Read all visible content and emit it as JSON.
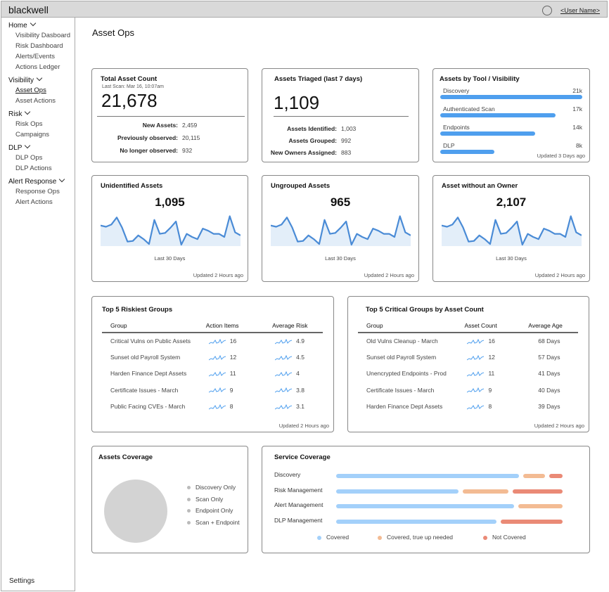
{
  "app": {
    "brand": "blackwell",
    "user_name": "<User Name>",
    "settings": "Settings"
  },
  "sidebar": [
    {
      "label": "Home",
      "items": [
        "Visibility Dasboard",
        "Risk Dashboard",
        "Alerts/Events",
        "Actions Ledger"
      ]
    },
    {
      "label": "Visibility",
      "items": [
        "Asset Ops",
        "Asset Actions"
      ],
      "active": "Asset Ops"
    },
    {
      "label": "Risk",
      "items": [
        "Risk Ops",
        "Campaigns"
      ]
    },
    {
      "label": "DLP",
      "items": [
        "DLP Ops",
        "DLP Actions"
      ]
    },
    {
      "label": "Alert Response",
      "items": [
        "Response Ops",
        "Alert Actions"
      ]
    }
  ],
  "page_title": "Asset Ops",
  "total": {
    "title": "Total Asset Count",
    "last_scan": "Last Scan: Mar 16, 10:07am",
    "value": "21,678",
    "rows": [
      {
        "k": "New Assets:",
        "v": "2,459"
      },
      {
        "k": "Previously observed:",
        "v": "20,115"
      },
      {
        "k": "No longer observed:",
        "v": "932"
      }
    ]
  },
  "triaged": {
    "title": "Assets Triaged (last 7 days)",
    "value": "1,109",
    "rows": [
      {
        "k": "Assets Identified:",
        "v": "1,003"
      },
      {
        "k": "Assets Grouped:",
        "v": "992"
      },
      {
        "k": "New Owners Assigned:",
        "v": "883"
      }
    ]
  },
  "by_tool": {
    "title": "Assets by Tool / Visibility",
    "updated": "Updated 3 Days ago",
    "color": "#4f9fee",
    "bars": [
      {
        "label": "Discovery",
        "value": "21k",
        "n": 21
      },
      {
        "label": "Authenticated Scan",
        "value": "17k",
        "n": 17
      },
      {
        "label": "Endpoints",
        "value": "14k",
        "n": 14
      },
      {
        "label": "DLP",
        "value": "8k",
        "n": 8
      }
    ]
  },
  "trend_cards": [
    {
      "title": "Unidentified Assets",
      "value": "1,095",
      "period": "Last 30 Days",
      "updated": "Updated 2 Hours ago"
    },
    {
      "title": "Ungrouped Assets",
      "value": "965",
      "period": "Last 30 Days",
      "updated": "Updated 2 Hours ago"
    },
    {
      "title": "Asset without an Owner",
      "value": "2,107",
      "period": "Last 30 Days",
      "updated": "Updated 2 Hours ago"
    }
  ],
  "sparkline": {
    "values": [
      62,
      58,
      65,
      88,
      55,
      10,
      12,
      30,
      18,
      2,
      80,
      35,
      38,
      55,
      75,
      0,
      35,
      25,
      18,
      52,
      45,
      35,
      35,
      25,
      92,
      40,
      30
    ],
    "line_color": "#4a8bd6",
    "fill_color": "#e3eef9"
  },
  "riskiest": {
    "title": "Top 5 Riskiest Groups",
    "updated": "Updated 2 Hours ago",
    "columns": [
      "Group",
      "Action Items",
      "Average Risk"
    ],
    "rows": [
      [
        "Critical Vulns on Public Assets",
        "16",
        "4.9"
      ],
      [
        "Sunset old Payroll System",
        "12",
        "4.5"
      ],
      [
        "Harden Finance Dept Assets",
        "11",
        "4"
      ],
      [
        "Certificate Issues - March",
        "9",
        "3.8"
      ],
      [
        "Public Facing CVEs - March",
        "8",
        "3.1"
      ]
    ]
  },
  "critical": {
    "title": "Top 5 Critical Groups by Asset Count",
    "updated": "Updated 2 Hours ago",
    "columns": [
      "Group",
      "Asset Count",
      "Average Age"
    ],
    "rows": [
      [
        "Old Vulns Cleanup - March",
        "16",
        "68 Days"
      ],
      [
        "Sunset old Payroll System",
        "12",
        "57 Days"
      ],
      [
        "Unencrypted Endpoints - Prod",
        "11",
        "41 Days"
      ],
      [
        "Certificate Issues - March",
        "9",
        "40 Days"
      ],
      [
        "Harden Finance Dept Assets",
        "8",
        "39 Days"
      ]
    ]
  },
  "assets_coverage": {
    "title": "Assets Coverage",
    "legend": [
      "Discovery Only",
      "Scan Only",
      "Endpoint Only",
      "Scan + Endpoint"
    ],
    "pie_color": "#d3d3d3"
  },
  "service_coverage": {
    "title": "Service Coverage",
    "legend": [
      {
        "label": "Covered",
        "color": "#a3d0fa"
      },
      {
        "label": "Covered, true up needed",
        "color": "#f3bb93"
      },
      {
        "label": "Not Covered",
        "color": "#ea8a76"
      }
    ],
    "rows": [
      {
        "label": "Discovery",
        "pct": [
          84,
          10,
          6
        ]
      },
      {
        "label": "Risk Management",
        "pct": [
          56,
          21,
          23
        ]
      },
      {
        "label": "Alert Management",
        "pct": [
          80,
          20,
          0
        ]
      },
      {
        "label": "DLP Management",
        "pct": [
          72,
          0,
          28
        ]
      }
    ]
  }
}
